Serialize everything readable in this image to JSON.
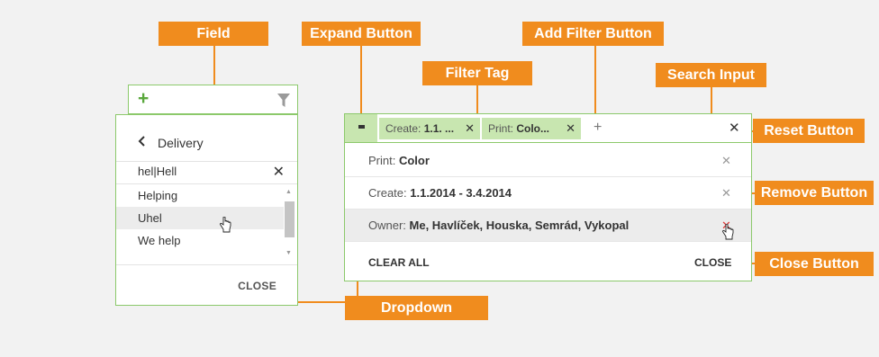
{
  "callouts": {
    "field": "Field",
    "expand_button": "Expand Button",
    "filter_tag": "Filter Tag",
    "add_filter_button": "Add Filter Button",
    "search_input": "Search Input",
    "reset_button": "Reset Button",
    "remove_button": "Remove Button",
    "close_button": "Close Button",
    "dropdown": "Dropdown"
  },
  "left_widget": {
    "field": {
      "add_icon": "plus-icon",
      "filter_icon": "funnel-icon"
    },
    "dropdown": {
      "back_glyph": "‹",
      "title": "Delivery",
      "search_value": "hel|Hell",
      "search_clear": "✕",
      "items": [
        "Helping",
        "Uhel",
        "We help"
      ],
      "hovered_item": "Uhel",
      "close_label": "CLOSE"
    }
  },
  "right_widget": {
    "tags": [
      {
        "label": "Create: ",
        "value": "1.1. ...",
        "remove": "✕"
      },
      {
        "label": "Print: ",
        "value": "Colo...",
        "remove": "✕"
      }
    ],
    "add_filter_glyph": "+",
    "reset_glyph": "✕",
    "rows": [
      {
        "label": "Print: ",
        "value": "Color",
        "remove": "✕"
      },
      {
        "label": "Create: ",
        "value": "1.1.2014 - 3.4.2014",
        "remove": "✕"
      },
      {
        "label": "Owner: ",
        "value": "Me, Havlíček, Houska, Semrád, Vykopal",
        "remove": "✕"
      }
    ],
    "clear_all_label": "CLEAR ALL",
    "close_label": "CLOSE"
  },
  "colors": {
    "accent": "#f08c1e",
    "border_green": "#8cc96b",
    "tag_bg": "#c8e6b0",
    "plus_green": "#5aa83c",
    "remove_hover": "#dd3333",
    "background": "#f2f2f2"
  }
}
